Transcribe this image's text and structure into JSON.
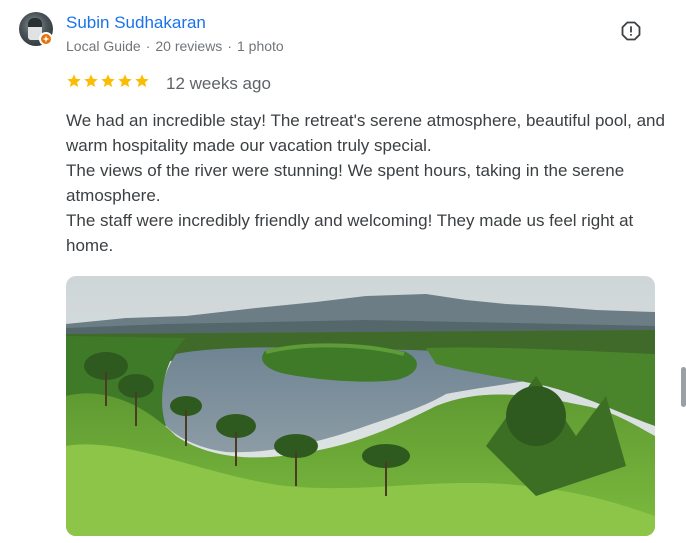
{
  "review": {
    "author_name": "Subin Sudhakaran",
    "meta": {
      "badge": "Local Guide",
      "reviews": "20 reviews",
      "photos": "1 photo",
      "separator": "·"
    },
    "rating": 5,
    "rating_max": 5,
    "time_ago": "12 weeks ago",
    "paragraphs": [
      "We had an incredible stay! The retreat's serene atmosphere, beautiful pool, and warm hospitality made our vacation truly special.",
      "The views of the river were stunning! We spent hours, taking in the serene atmosphere.",
      "The staff were incredibly friendly and welcoming! They made us feel right at home."
    ],
    "icons": {
      "report": "report-flag-icon",
      "star": "star-icon",
      "local_guide": "local-guide-badge-icon"
    },
    "colors": {
      "author": "#1a73e8",
      "star": "#fbbc04",
      "meta": "#70757a",
      "local_guide_badge": "#e8710a"
    }
  }
}
